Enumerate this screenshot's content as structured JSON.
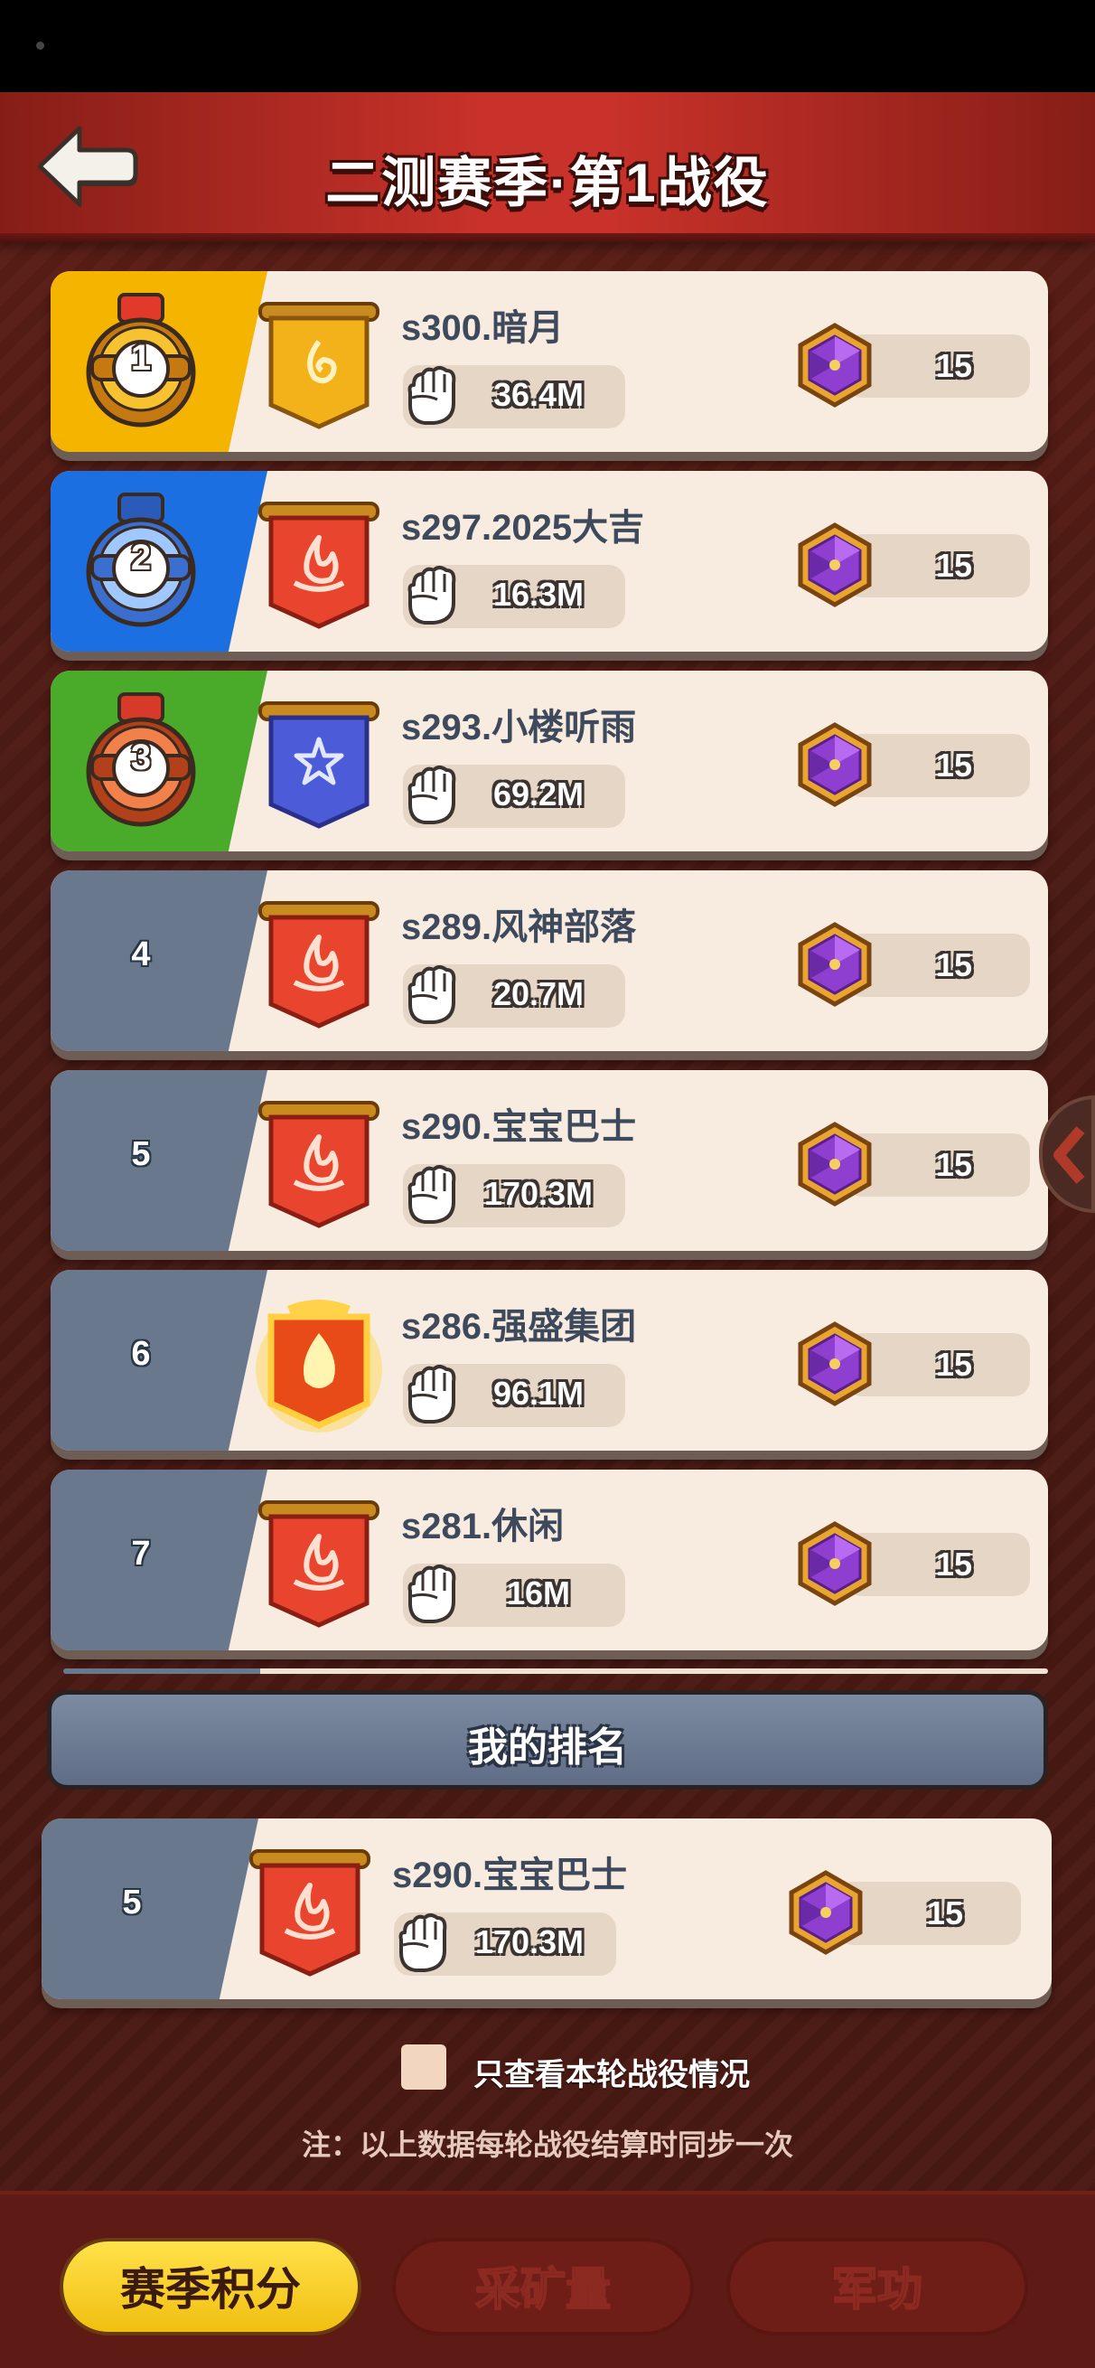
{
  "header": {
    "title": "二测赛季·第1战役"
  },
  "colors": {
    "gold_rank": "#f5b400",
    "silver_rank": "#1c6fe0",
    "bronze_rank": "#4aab2a",
    "normal_rank": "#69788c",
    "card_bg": "#f8ece1",
    "active_tab": "#f7cf20"
  },
  "icons": {
    "back": "back-arrow-icon",
    "power": "fist-icon",
    "score": "purple-gem-icon"
  },
  "rankings": [
    {
      "rank": "1",
      "server": "s300.暗月",
      "power": "36.4M",
      "score": "15",
      "banner": "gold"
    },
    {
      "rank": "2",
      "server": "s297.2025大吉",
      "power": "16.3M",
      "score": "15",
      "banner": "red"
    },
    {
      "rank": "3",
      "server": "s293.小楼听雨",
      "power": "69.2M",
      "score": "15",
      "banner": "blue"
    },
    {
      "rank": "4",
      "server": "s289.风神部落",
      "power": "20.7M",
      "score": "15",
      "banner": "red"
    },
    {
      "rank": "5",
      "server": "s290.宝宝巴士",
      "power": "170.3M",
      "score": "15",
      "banner": "red"
    },
    {
      "rank": "6",
      "server": "s286.强盛集团",
      "power": "96.1M",
      "score": "15",
      "banner": "fire"
    },
    {
      "rank": "7",
      "server": "s281.休闲",
      "power": "16M",
      "score": "15",
      "banner": "red"
    }
  ],
  "my_rank": {
    "label": "我的排名",
    "rank": "5",
    "server": "s290.宝宝巴士",
    "power": "170.3M",
    "score": "15"
  },
  "filter": {
    "label": "只查看本轮战役情况",
    "checked": false
  },
  "note": "注：以上数据每轮战役结算时同步一次",
  "tabs": [
    {
      "label": "赛季积分",
      "active": true
    },
    {
      "label": "采矿量",
      "active": false
    },
    {
      "label": "军功",
      "active": false
    }
  ]
}
